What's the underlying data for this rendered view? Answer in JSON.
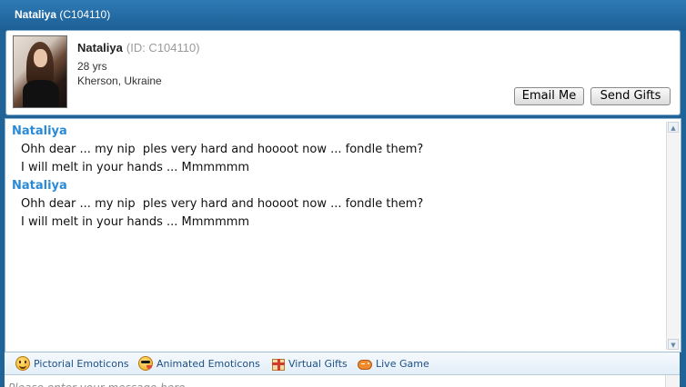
{
  "window": {
    "title_name": "Nataliya",
    "title_id": "(C104110)"
  },
  "profile": {
    "name": "Nataliya",
    "id_text": "(ID: C104110)",
    "age": "28 yrs",
    "location": "Kherson, Ukraine",
    "email_button": "Email Me",
    "gifts_button": "Send Gifts"
  },
  "chat": {
    "messages": [
      {
        "sender": "Nataliya",
        "lines": [
          "Ohh dear ... my nip  ples very hard and hoooot now ... fondle them?",
          "I will melt in your hands ... Mmmmmm"
        ]
      },
      {
        "sender": "Nataliya",
        "lines": [
          "Ohh dear ... my nip  ples very hard and hoooot now ... fondle them?",
          "I will melt in your hands ... Mmmmmm"
        ]
      }
    ]
  },
  "toolbar": {
    "items": [
      {
        "label": "Pictorial Emoticons",
        "icon": "smiley-icon"
      },
      {
        "label": "Animated Emoticons",
        "icon": "animated-smiley-icon"
      },
      {
        "label": "Virtual Gifts",
        "icon": "gift-icon"
      },
      {
        "label": "Live Game",
        "icon": "gamepad-icon"
      }
    ]
  },
  "input": {
    "placeholder": "Please enter your message here"
  },
  "colors": {
    "title_bar": "#1f6398",
    "sender_name": "#2b8ad6",
    "toolbar_text": "#1d4f86"
  }
}
